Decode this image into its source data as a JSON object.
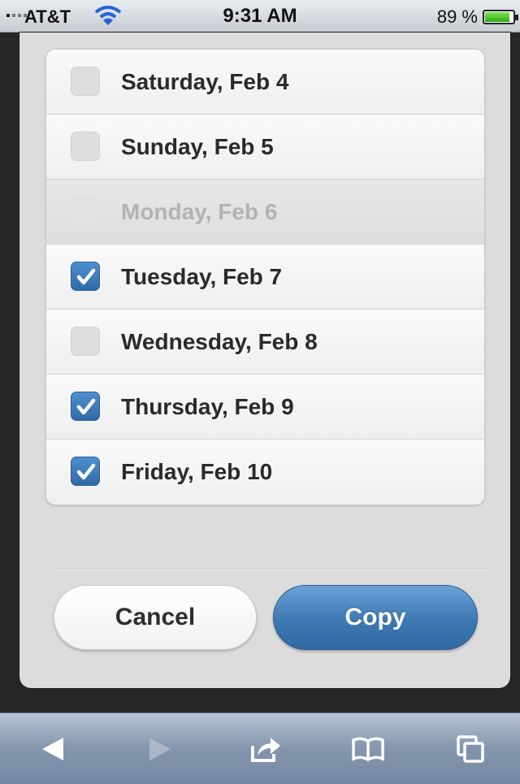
{
  "status_bar": {
    "carrier": "AT&T",
    "time": "9:31 AM",
    "battery": "89 %",
    "battery_level": 0.89,
    "icons": [
      "signal-icon",
      "wifi-icon",
      "battery-icon"
    ]
  },
  "day_list": [
    {
      "label": "Saturday, Feb 4",
      "checked": false,
      "disabled": false
    },
    {
      "label": "Sunday, Feb 5",
      "checked": false,
      "disabled": false
    },
    {
      "label": "Monday, Feb 6",
      "checked": false,
      "disabled": true
    },
    {
      "label": "Tuesday, Feb 7",
      "checked": true,
      "disabled": false
    },
    {
      "label": "Wednesday, Feb 8",
      "checked": false,
      "disabled": false
    },
    {
      "label": "Thursday, Feb 9",
      "checked": true,
      "disabled": false
    },
    {
      "label": "Friday, Feb 10",
      "checked": true,
      "disabled": false
    }
  ],
  "actions": {
    "cancel_label": "Cancel",
    "copy_label": "Copy"
  },
  "toolbar": {
    "icons": [
      "back-icon",
      "forward-icon",
      "share-icon",
      "bookmarks-icon",
      "tabs-icon"
    ]
  },
  "colors": {
    "accent": "#3d78b2",
    "checkbox_checked": "#3b77b3",
    "toolbar": "#8496ad"
  }
}
